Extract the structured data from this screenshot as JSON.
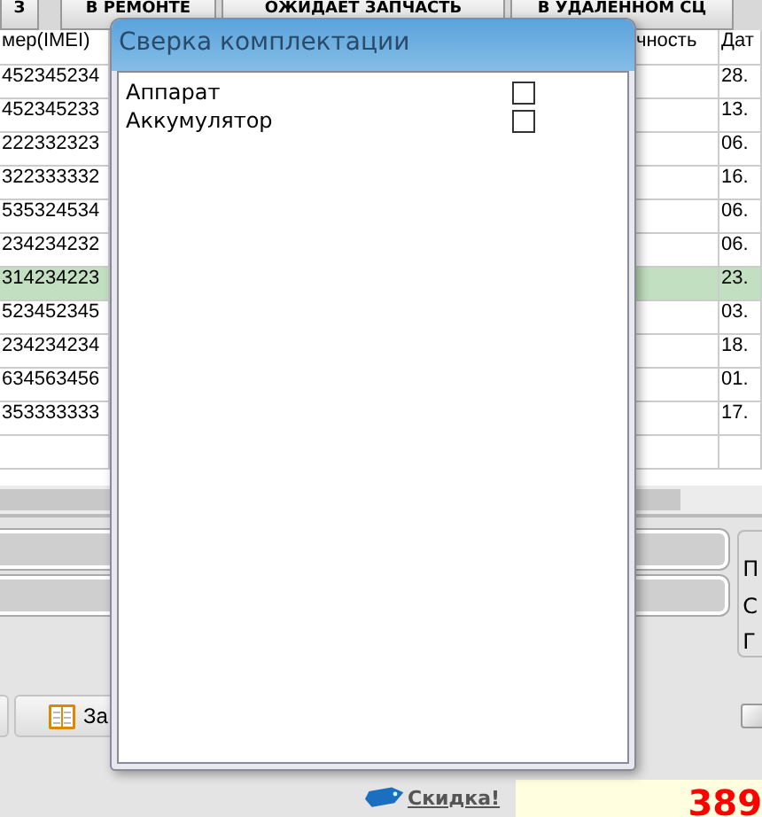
{
  "tabs": [
    {
      "label": "З"
    },
    {
      "label": "В РЕМОНТЕ"
    },
    {
      "label": "ОЖИДАЕТ ЗАПЧАСТЬ"
    },
    {
      "label": "В УДАЛЕННОМ СЦ"
    }
  ],
  "table": {
    "columns": [
      "мер(IMEI)",
      "чность",
      "Дат"
    ],
    "rows": [
      {
        "cells": [
          "452345234",
          "28."
        ],
        "selected": false
      },
      {
        "cells": [
          "452345233",
          "13."
        ],
        "selected": false
      },
      {
        "cells": [
          "222332323",
          "06."
        ],
        "selected": false
      },
      {
        "cells": [
          "322333332",
          "16."
        ],
        "selected": false
      },
      {
        "cells": [
          "535324534",
          "06."
        ],
        "selected": false
      },
      {
        "cells": [
          "234234232",
          "06."
        ],
        "selected": false
      },
      {
        "cells": [
          "314234223",
          "23."
        ],
        "selected": true
      },
      {
        "cells": [
          "523452345",
          "03."
        ],
        "selected": false
      },
      {
        "cells": [
          "234234234",
          "18."
        ],
        "selected": false
      },
      {
        "cells": [
          "634563456",
          "01."
        ],
        "selected": false
      },
      {
        "cells": [
          "353333333",
          "17."
        ],
        "selected": false
      }
    ]
  },
  "group_labels": [
    "П",
    "С",
    "Г"
  ],
  "toolbar": {
    "buttons": [
      {
        "label": "За"
      }
    ],
    "option": {
      "checked": false
    }
  },
  "discount_link": "Скидка!",
  "total": "389",
  "dialog": {
    "title": "Сверка комплектации",
    "items": [
      {
        "label": "Аппарат",
        "checked": false
      },
      {
        "label": "Аккумулятор",
        "checked": false
      }
    ]
  }
}
